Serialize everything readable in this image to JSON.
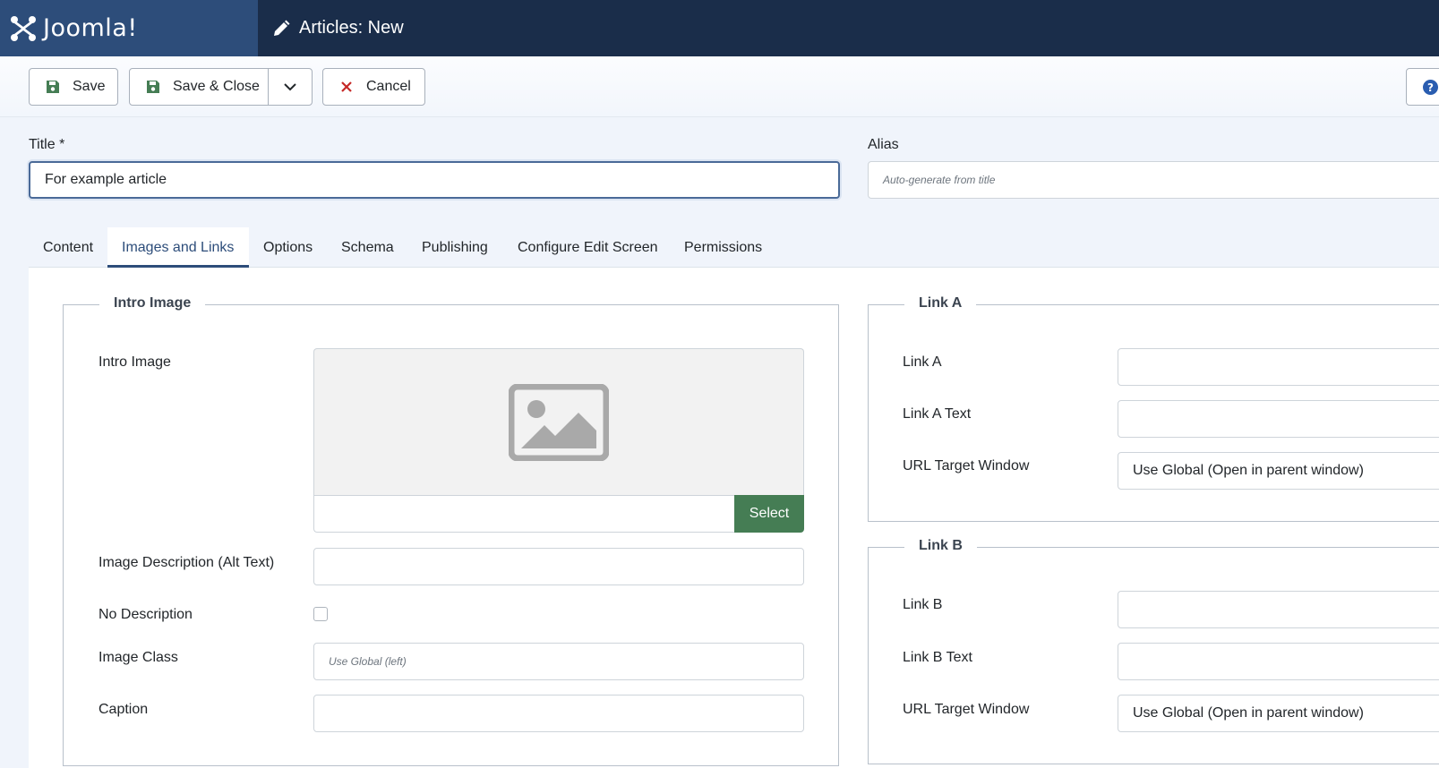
{
  "header": {
    "logo_text": "Joomla!",
    "page_title": "Articles: New"
  },
  "toolbar": {
    "save_label": "Save",
    "save_close_label": "Save & Close",
    "cancel_label": "Cancel"
  },
  "form": {
    "title_label": "Title *",
    "title_value": "For example article",
    "alias_label": "Alias",
    "alias_placeholder": "Auto-generate from title"
  },
  "tabs": [
    {
      "label": "Content",
      "active": false
    },
    {
      "label": "Images and Links",
      "active": true
    },
    {
      "label": "Options",
      "active": false
    },
    {
      "label": "Schema",
      "active": false
    },
    {
      "label": "Publishing",
      "active": false
    },
    {
      "label": "Configure Edit Screen",
      "active": false
    },
    {
      "label": "Permissions",
      "active": false
    }
  ],
  "intro_image": {
    "legend": "Intro Image",
    "image_label": "Intro Image",
    "select_label": "Select",
    "alt_label": "Image Description (Alt Text)",
    "no_desc_label": "No Description",
    "class_label": "Image Class",
    "class_placeholder": "Use Global (left)",
    "caption_label": "Caption"
  },
  "link_a": {
    "legend": "Link A",
    "link_label": "Link A",
    "text_label": "Link A Text",
    "target_label": "URL Target Window",
    "target_value": "Use Global (Open in parent window)"
  },
  "link_b": {
    "legend": "Link B",
    "link_label": "Link B",
    "text_label": "Link B Text",
    "target_label": "URL Target Window",
    "target_value": "Use Global (Open in parent window)"
  },
  "colors": {
    "header_bg": "#1a2d4a",
    "logo_bg": "#2d4d7a",
    "select_green": "#457d54",
    "cancel_red": "#c52827",
    "save_icon_green": "#457d54"
  }
}
